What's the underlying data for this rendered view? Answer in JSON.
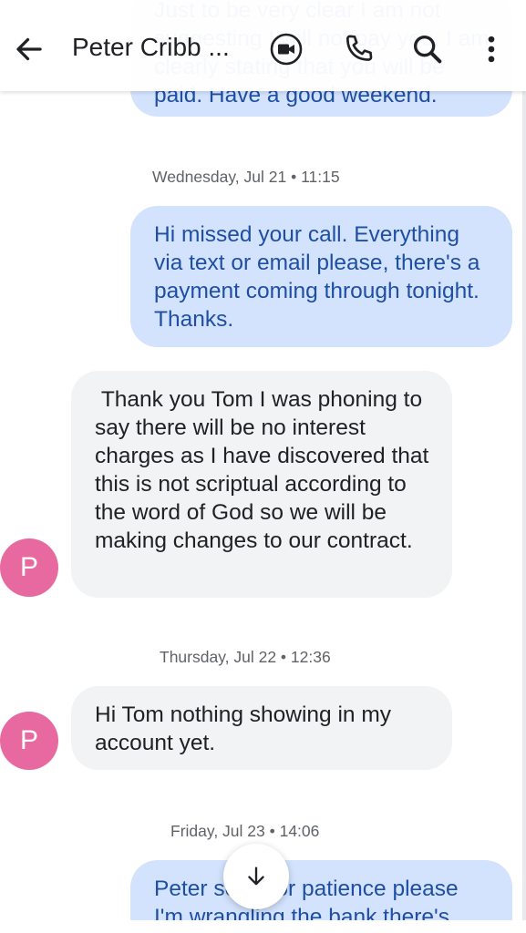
{
  "header": {
    "title": "Peter Cribb ...",
    "icons": [
      "back-arrow-icon",
      "video-call-icon",
      "phone-icon",
      "search-icon",
      "more-vert-icon"
    ]
  },
  "thread": {
    "partial_top_text": "Just to be very clear I am not suggesting I will not pay you. I am clearly stating that you will be paid. Have a good weekend.",
    "stamps": {
      "wed": "Wednesday, Jul 21 • 11:15",
      "thu": "Thursday, Jul 22 • 12:36",
      "fri": "Friday, Jul 23 • 14:06"
    },
    "messages": {
      "m1": "Hi missed your call. Everything via text or email please, there's a payment coming through tonight. Thanks.",
      "m2": " Thank you Tom I was phoning to say there will be no interest charges as I have discovered that this is not scriptual according to the word of God so we will be making changes to our contract.",
      "m3": "Hi Tom nothing showing in my account yet.",
      "m4": "Peter sorry for patience please I'm wrangling the bank there's light"
    },
    "avatar_initial": "P"
  },
  "colors": {
    "outgoing_bubble": "#d3e3fd",
    "outgoing_text": "#1f4fa5",
    "incoming_bubble": "#f1f3f4",
    "avatar": "#e8699f"
  }
}
